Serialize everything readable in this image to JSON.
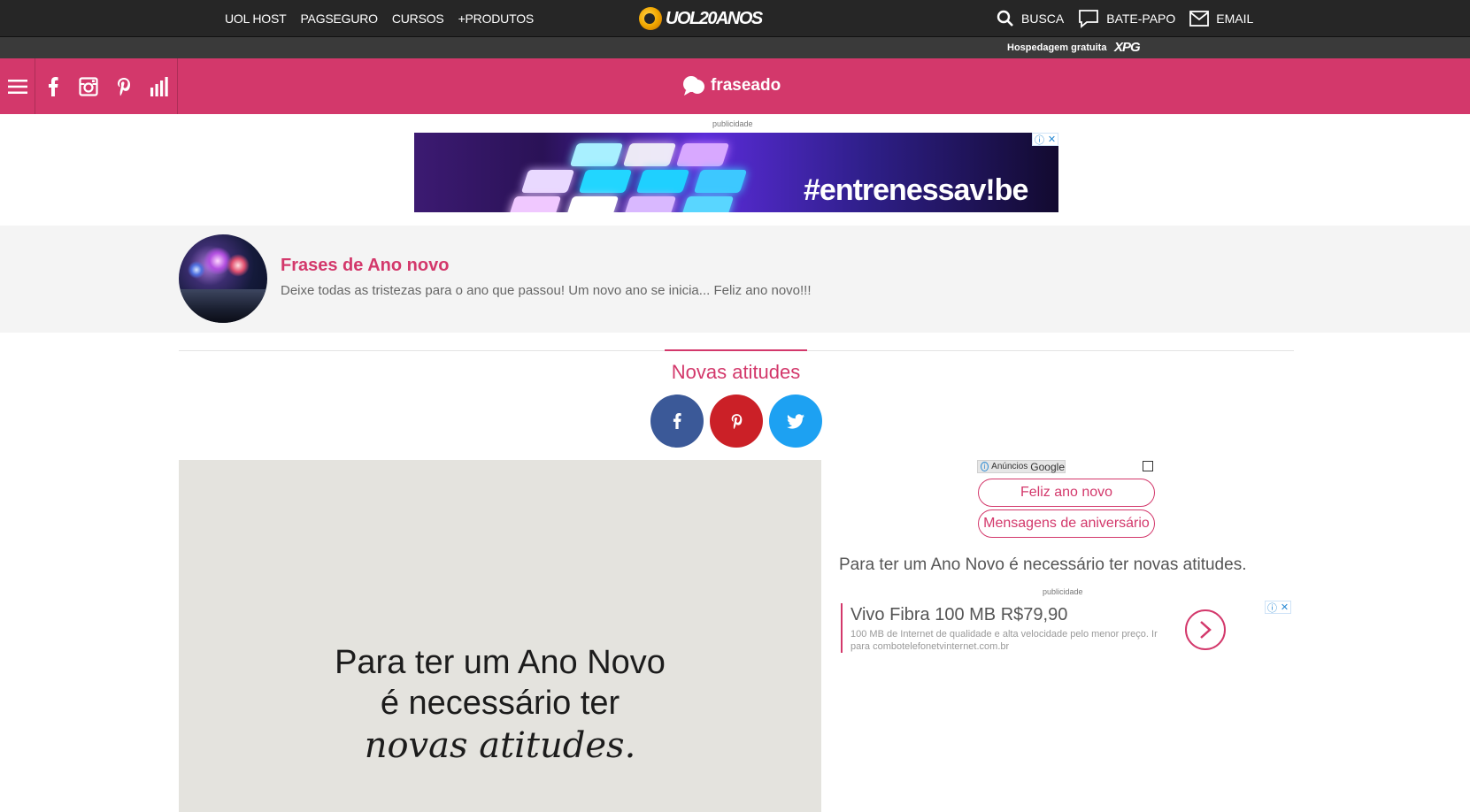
{
  "uol_bar": {
    "links": [
      "UOL HOST",
      "PAGSEGURO",
      "CURSOS",
      "+PRODUTOS"
    ],
    "logo_text": "UOL20ANOS",
    "search_label": "BUSCA",
    "chat_label": "BATE-PAPO",
    "email_label": "EMAIL"
  },
  "host_strip": {
    "text": "Hospedagem gratuita",
    "logo": "XPG"
  },
  "header": {
    "brand": "fraseado",
    "icons": [
      "menu-icon",
      "facebook-icon",
      "instagram-icon",
      "pinterest-icon",
      "ranking-icon"
    ],
    "color": "#d3386b"
  },
  "top_ad": {
    "label": "publicidade",
    "hashtag": "#entrenessav!be"
  },
  "profile": {
    "title": "Frases de Ano novo",
    "description": "Deixe todas as tristezas para o ano que passou! Um novo ano se inicia... Feliz ano novo!!!"
  },
  "main": {
    "section_title": "Novas atitudes",
    "share_buttons": [
      {
        "icon": "facebook-icon",
        "color": "#3b5998"
      },
      {
        "icon": "pinterest-icon",
        "color": "#cb2027"
      },
      {
        "icon": "twitter-icon",
        "color": "#1da1f2"
      }
    ],
    "quote_image": {
      "line1": "Para ter um Ano Novo",
      "line2": "é necessário ter",
      "line3": "novas atitudes."
    }
  },
  "sidebar": {
    "adchoices_label": "Anúncios",
    "adchoices_brand": "Google",
    "pills": [
      "Feliz ano novo",
      "Mensagens de aniversário"
    ],
    "quote_text": "Para ter um Ano Novo é necessário ter novas atitudes.",
    "ad_label": "publicidade",
    "text_ad": {
      "title": "Vivo Fibra 100 MB R$79,90",
      "description": "100 MB de Internet de qualidade e alta velocidade pelo menor preço. Ir para combotelefonetvinternet.com.br"
    }
  }
}
